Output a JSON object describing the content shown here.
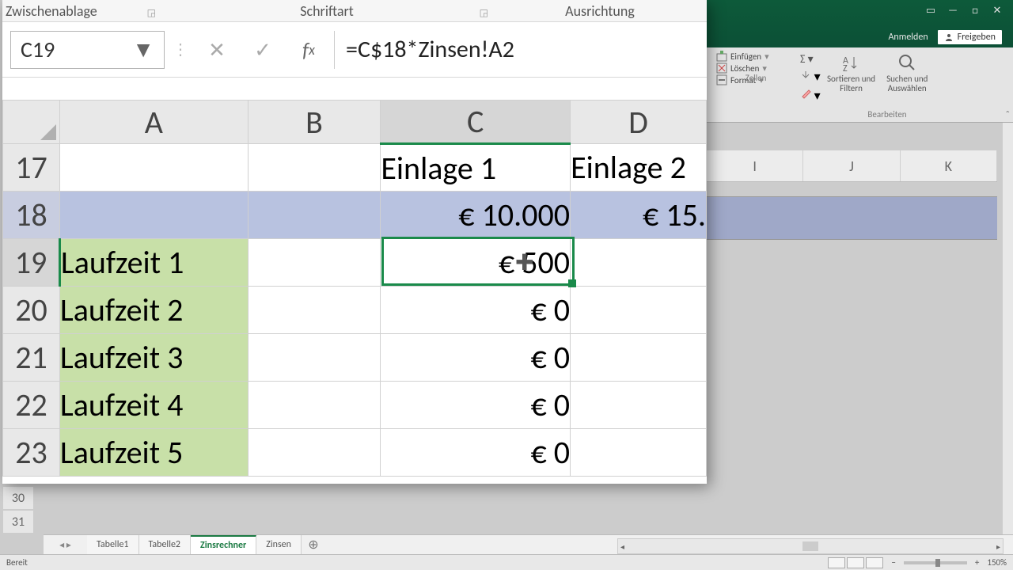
{
  "ribbon_groups_fg": {
    "clipboard": "Zwischenablage",
    "font": "Schriftart",
    "alignment": "Ausrichtung"
  },
  "ribbon_right": {
    "insert": "Einfügen",
    "delete": "Löschen",
    "format": "Format",
    "sort_filter": "Sortieren und\nFiltern",
    "find_select": "Suchen und\nAuswählen",
    "group_cells": "Zellen",
    "group_edit": "Bearbeiten"
  },
  "auth": {
    "signin": "Anmelden",
    "share": "Freigeben"
  },
  "namebox": "C19",
  "formula": "=C$18*Zinsen!A2",
  "columns": {
    "A": "A",
    "B": "B",
    "C": "C",
    "D": "D"
  },
  "bg_columns": [
    "I",
    "J",
    "K"
  ],
  "bg_rows": [
    "30",
    "31"
  ],
  "rows": {
    "17": {
      "n": "17",
      "C": "Einlage 1",
      "D": "Einlage 2"
    },
    "18": {
      "n": "18",
      "C": "€ 10.000",
      "D": "€ 15."
    },
    "19": {
      "n": "19",
      "A": "Laufzeit 1",
      "C": "€ 500"
    },
    "20": {
      "n": "20",
      "A": "Laufzeit 2",
      "C": "€ 0"
    },
    "21": {
      "n": "21",
      "A": "Laufzeit 3",
      "C": "€ 0"
    },
    "22": {
      "n": "22",
      "A": "Laufzeit 4",
      "C": "€ 0"
    },
    "23": {
      "n": "23",
      "A": "Laufzeit 5",
      "C": "€ 0"
    }
  },
  "tabs": {
    "t1": "Tabelle1",
    "t2": "Tabelle2",
    "t3": "Zinsrechner",
    "t4": "Zinsen"
  },
  "status": {
    "ready": "Bereit",
    "zoom": "150%"
  }
}
